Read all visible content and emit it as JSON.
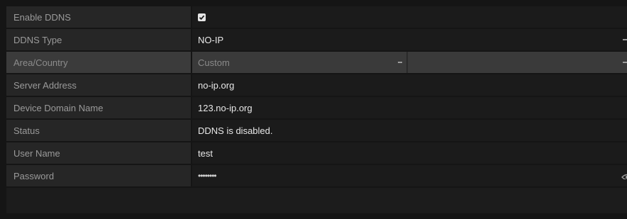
{
  "rows": [
    {
      "label": "Enable DDNS",
      "value": "",
      "type": "checkbox",
      "checked": true
    },
    {
      "label": "DDNS Type",
      "value": "NO-IP",
      "type": "dropdown"
    },
    {
      "label": "Area/Country",
      "value": "Custom",
      "value2": "",
      "type": "double-dropdown",
      "disabled": true
    },
    {
      "label": "Server Address",
      "value": "no-ip.org",
      "type": "text"
    },
    {
      "label": "Device Domain Name",
      "value": "123.no-ip.org",
      "type": "text"
    },
    {
      "label": "Status",
      "value": "DDNS is disabled.",
      "type": "static"
    },
    {
      "label": "User Name",
      "value": "test",
      "type": "text"
    },
    {
      "label": "Password",
      "value": "••••••••",
      "type": "password"
    }
  ],
  "colors": {
    "background": "#151515",
    "label_bg": "#262626",
    "value_bg": "#1b1b1b",
    "disabled_bg": "#3a3a3a",
    "text": "#e8e8e8",
    "label_text": "#9a9a9a"
  },
  "icons": {
    "checkbox": "checkbox-checked-icon",
    "dropdown": "chevron-down-icon",
    "password": "eye-icon"
  }
}
